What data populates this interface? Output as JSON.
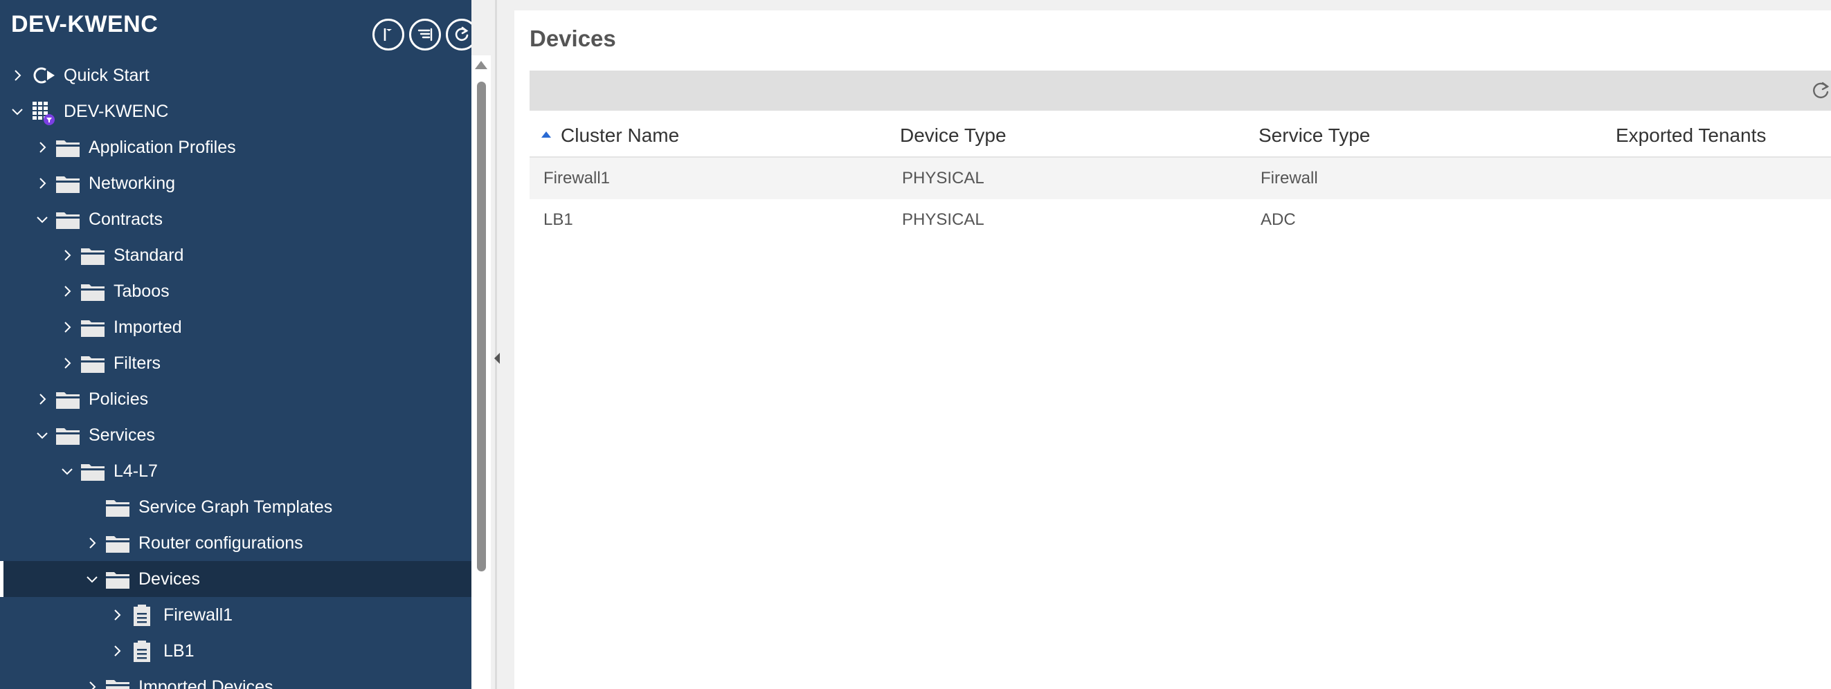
{
  "sidebar": {
    "title": "DEV-KWENC",
    "header_buttons": [
      {
        "name": "tag-flag-icon"
      },
      {
        "name": "filter-list-icon"
      },
      {
        "name": "refresh-icon"
      }
    ],
    "tree": [
      {
        "label": "Quick Start",
        "icon": "quick-start-icon",
        "expanded": false
      },
      {
        "label": "DEV-KWENC",
        "icon": "tenant-icon",
        "expanded": true
      },
      {
        "label": "Application Profiles",
        "icon": "folder-icon",
        "expanded": false
      },
      {
        "label": "Networking",
        "icon": "folder-icon",
        "expanded": false
      },
      {
        "label": "Contracts",
        "icon": "folder-icon",
        "expanded": true
      },
      {
        "label": "Standard",
        "icon": "folder-icon",
        "expanded": false
      },
      {
        "label": "Taboos",
        "icon": "folder-icon",
        "expanded": false
      },
      {
        "label": "Imported",
        "icon": "folder-icon",
        "expanded": false
      },
      {
        "label": "Filters",
        "icon": "folder-icon",
        "expanded": false
      },
      {
        "label": "Policies",
        "icon": "folder-icon",
        "expanded": false
      },
      {
        "label": "Services",
        "icon": "folder-icon",
        "expanded": true
      },
      {
        "label": "L4-L7",
        "icon": "folder-icon",
        "expanded": true
      },
      {
        "label": "Service Graph Templates",
        "icon": "folder-icon",
        "expanded": null
      },
      {
        "label": "Router configurations",
        "icon": "folder-icon",
        "expanded": false
      },
      {
        "label": "Devices",
        "icon": "folder-icon",
        "expanded": true,
        "selected": true
      },
      {
        "label": "Firewall1",
        "icon": "device-icon",
        "expanded": false
      },
      {
        "label": "LB1",
        "icon": "device-icon",
        "expanded": false
      },
      {
        "label": "Imported Devices",
        "icon": "folder-icon",
        "expanded": false
      }
    ]
  },
  "main": {
    "title": "Devices",
    "table": {
      "sorted_column": "Cluster Name",
      "sort_direction": "ascending",
      "columns": [
        "Cluster Name",
        "Device Type",
        "Service Type",
        "Exported Tenants"
      ],
      "rows": [
        [
          "Firewall1",
          "PHYSICAL",
          "Firewall",
          ""
        ],
        [
          "LB1",
          "PHYSICAL",
          "ADC",
          ""
        ]
      ]
    }
  },
  "colors": {
    "sidebar_bg": "#244264",
    "sidebar_selected": "#1a3049",
    "toolbar_bg": "#dfdfdf",
    "sort_arrow": "#2a6ad3"
  }
}
